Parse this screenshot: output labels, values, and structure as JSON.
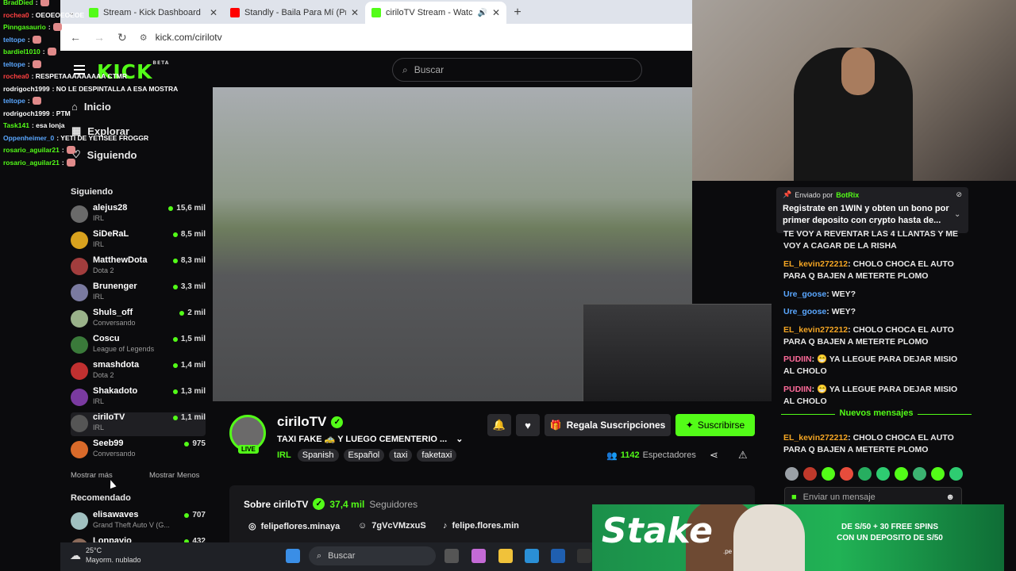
{
  "browser": {
    "tabs": [
      {
        "title": "Stream - Kick Dashboard",
        "favicon_color": "#53fc18"
      },
      {
        "title": "Standly - Baila Para Mí (Prod. B",
        "favicon_color": "#ff0000"
      },
      {
        "title": "ciriloTV Stream - Watch Liv",
        "favicon_color": "#53fc18"
      }
    ],
    "url": "kick.com/cirilotv"
  },
  "kick": {
    "logo": "KICK",
    "logo_badge": "BETA",
    "search_placeholder": "Buscar",
    "nav": [
      "Inicio",
      "Explorar",
      "Siguiendo"
    ],
    "following_title": "Siguiendo",
    "following": [
      {
        "name": "alejus28",
        "category": "IRL",
        "viewers": "15,6 mil",
        "color": "#6a6a6a"
      },
      {
        "name": "SiDeRaL",
        "category": "IRL",
        "viewers": "8,5 mil",
        "color": "#d9a21e"
      },
      {
        "name": "MatthewDota",
        "category": "Dota 2",
        "viewers": "8,3 mil",
        "color": "#a23d3d"
      },
      {
        "name": "Brunenger",
        "category": "IRL",
        "viewers": "3,3 mil",
        "color": "#7a7aa0"
      },
      {
        "name": "Shuls_off",
        "category": "Conversando",
        "viewers": "2 mil",
        "color": "#9ab28a"
      },
      {
        "name": "Coscu",
        "category": "League of Legends",
        "viewers": "1,5 mil",
        "color": "#3a7a3a"
      },
      {
        "name": "smashdota",
        "category": "Dota 2",
        "viewers": "1,4 mil",
        "color": "#c03030"
      },
      {
        "name": "Shakadoto",
        "category": "IRL",
        "viewers": "1,3 mil",
        "color": "#7a3aa0"
      },
      {
        "name": "ciriloTV",
        "category": "IRL",
        "viewers": "1,1 mil",
        "color": "#555555"
      },
      {
        "name": "Seeb99",
        "category": "Conversando",
        "viewers": "975",
        "color": "#d96a2a"
      }
    ],
    "show_more": "Mostrar más",
    "show_less": "Mostrar Menos",
    "recommended_title": "Recomendado",
    "recommended": [
      {
        "name": "elisawaves",
        "category": "Grand Theft Auto V (G...",
        "viewers": "707",
        "color": "#a0c0c0"
      },
      {
        "name": "Lonpavio",
        "category": "",
        "viewers": "432",
        "color": "#8a6a5a"
      }
    ]
  },
  "stream": {
    "channel": "ciriloTV",
    "live_badge": "LIVE",
    "title": "TAXI FAKE 🚕 Y LUEGO CEMENTERIO ...",
    "category": "IRL",
    "tags": [
      "Spanish",
      "Español",
      "taxi",
      "faketaxi"
    ],
    "gift_button": "Regala Suscripciones",
    "subscribe_button": "Suscribirse",
    "viewers_count": "1142",
    "viewers_label": "Espectadores",
    "about_title": "Sobre ciriloTV",
    "followers_count": "37,4 mil",
    "followers_label": "Seguidores",
    "socials": [
      {
        "icon": "instagram-icon",
        "handle": "felipeflores.minaya"
      },
      {
        "icon": "discord-icon",
        "handle": "7gVcVMzxuS"
      },
      {
        "icon": "tiktok-icon",
        "handle": "felipe.flores.min"
      }
    ]
  },
  "chat": {
    "pinned_by_label": "Enviado por",
    "pinned_by": "BotRix",
    "pinned_message": "Registrate en 1WIN y obten un bono por primer deposito con crypto hasta de...",
    "messages": [
      {
        "user": "",
        "text": "TE VOY A REVENTAR LAS 4 LLANTAS Y ME VOY A CAGAR DE LA RISHA",
        "color": "#e8e8e8"
      },
      {
        "user": "EL_kevin272212",
        "text": ": CHOLO CHOCA EL AUTO PARA Q BAJEN A METERTE PLOMO",
        "color": "#f5a623"
      },
      {
        "user": "Ure_goose",
        "text": ": WEY?",
        "color": "#5aa7ff"
      },
      {
        "user": "Ure_goose",
        "text": ": WEY?",
        "color": "#5aa7ff"
      },
      {
        "user": "EL_kevin272212",
        "text": ": CHOLO CHOCA EL AUTO PARA Q BAJEN A METERTE PLOMO",
        "color": "#f5a623"
      },
      {
        "user": "PUDIIN",
        "text": ": 😁 YA LLEGUE PARA DEJAR MISIO AL CHOLO",
        "color": "#ff6b9a"
      },
      {
        "user": "PUDIIN",
        "text": ": 😁 YA LLEGUE PARA DEJAR MISIO AL CHOLO",
        "color": "#ff6b9a"
      }
    ],
    "new_messages_label": "Nuevos mensajes",
    "after_new": {
      "user": "EL_kevin272212",
      "text": ": CHOLO CHOCA EL AUTO PARA Q BAJEN A METERTE PLOMO",
      "color": "#f5a623"
    },
    "input_placeholder": "Enviar un mensaje"
  },
  "overlay_chat": [
    {
      "user": "BradDied",
      "text": ":",
      "color": "#53fc18"
    },
    {
      "user": "rochea0",
      "text": ": OEOEOEOEOE",
      "color": "#ff4040"
    },
    {
      "user": "Pinngasaurio",
      "text": ":",
      "color": "#53fc18"
    },
    {
      "user": "teltope",
      "text": ":",
      "color": "#5aa7ff"
    },
    {
      "user": "bardiel1010",
      "text": ":",
      "color": "#53fc18"
    },
    {
      "user": "teltope",
      "text": ":",
      "color": "#5aa7ff"
    },
    {
      "user": "rochea0",
      "text": ": RESPETAAAAAAAAA CTMR",
      "color": "#ff4040"
    },
    {
      "user": "rodrigoch1999",
      "text": ": NO LE DESPINTALLA A ESA MOSTRA",
      "color": "#ffffff"
    },
    {
      "user": "teltope",
      "text": ":",
      "color": "#5aa7ff"
    },
    {
      "user": "rodrigoch1999",
      "text": ": PTM",
      "color": "#ffffff"
    },
    {
      "user": "Task141",
      "text": ": esa lonja",
      "color": "#53fc18"
    },
    {
      "user": "Oppenheimer_0",
      "text": ": YETI DE YETISEE FROGGR",
      "color": "#5aa7ff"
    },
    {
      "user": "rosario_aguilar21",
      "text": ":",
      "color": "#53fc18"
    },
    {
      "user": "rosario_aguilar21",
      "text": ":",
      "color": "#53fc18"
    }
  ],
  "ad": {
    "brand": "Stake",
    "brand_suffix": ".pe",
    "promo_line1": "DE S/50 + 30 FREE SPINS",
    "promo_line2": "CON UN DEPOSITO DE S/50"
  },
  "taskbar": {
    "temperature": "25°C",
    "weather": "Mayorm. nublado",
    "search_placeholder": "Buscar"
  }
}
